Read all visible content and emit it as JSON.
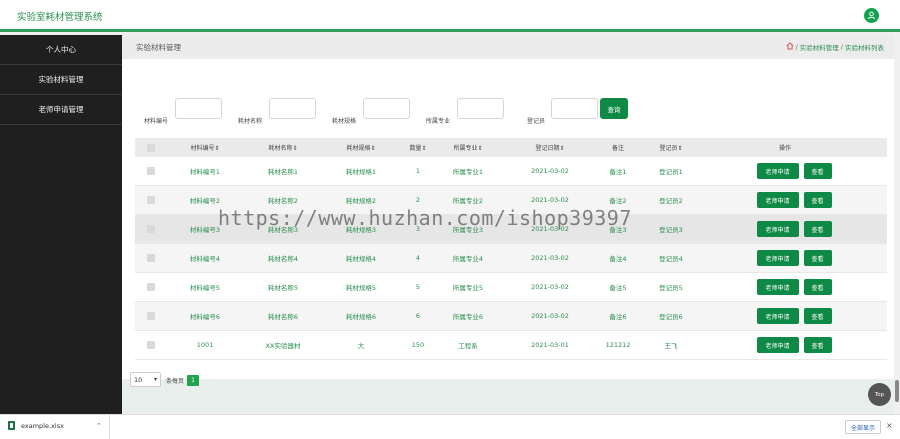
{
  "header": {
    "app_title": "实验室耗材管理系统",
    "user_icon": "user-icon"
  },
  "sidebar": {
    "items": [
      {
        "label": "个人中心"
      },
      {
        "label": "实验材料管理"
      },
      {
        "label": "老师申请管理"
      }
    ]
  },
  "breadcrumb": {
    "page_title": "实验材料管理",
    "sep": "/",
    "level1": "实验材料管理",
    "level2": "实验材料列表"
  },
  "filters": [
    {
      "label": "材料编号"
    },
    {
      "label": "耗材名称"
    },
    {
      "label": "耗材规格"
    },
    {
      "label": "所属专业"
    },
    {
      "label": "登记员"
    }
  ],
  "query_button": "查询",
  "table": {
    "headers": [
      "材料编号⇕",
      "耗材名称⇕",
      "耗材规格⇕",
      "数量⇕",
      "所属专业⇕",
      "登记日期⇕",
      "备注",
      "登记员⇕",
      "操作"
    ],
    "rows": [
      {
        "code": "材料编号1",
        "name": "耗材名称1",
        "spec": "耗材规格1",
        "qty": "1",
        "major": "所属专业1",
        "date": "2021-03-02",
        "note": "备注1",
        "registrar": "登记员1"
      },
      {
        "code": "材料编号2",
        "name": "耗材名称2",
        "spec": "耗材规格2",
        "qty": "2",
        "major": "所属专业2",
        "date": "2021-03-02",
        "note": "备注2",
        "registrar": "登记员2"
      },
      {
        "code": "材料编号3",
        "name": "耗材名称3",
        "spec": "耗材规格3",
        "qty": "3",
        "major": "所属专业3",
        "date": "2021-03-02",
        "note": "备注3",
        "registrar": "登记员3"
      },
      {
        "code": "材料编号4",
        "name": "耗材名称4",
        "spec": "耗材规格4",
        "qty": "4",
        "major": "所属专业4",
        "date": "2021-03-02",
        "note": "备注4",
        "registrar": "登记员4"
      },
      {
        "code": "材料编号5",
        "name": "耗材名称5",
        "spec": "耗材规格5",
        "qty": "5",
        "major": "所属专业5",
        "date": "2021-03-02",
        "note": "备注5",
        "registrar": "登记员5"
      },
      {
        "code": "材料编号6",
        "name": "耗材名称6",
        "spec": "耗材规格6",
        "qty": "6",
        "major": "所属专业6",
        "date": "2021-03-02",
        "note": "备注6",
        "registrar": "登记员6"
      },
      {
        "code": "1001",
        "name": "XX实验器材",
        "spec": "大",
        "qty": "150",
        "major": "工程系",
        "date": "2021-03-01",
        "note": "121212",
        "registrar": "王飞"
      }
    ],
    "action_teacher": "老师申请",
    "action_view": "查看"
  },
  "pager": {
    "page_size": "10",
    "per_page_label": "条每页",
    "current_page": "1"
  },
  "top_button": "Top",
  "watermark": "https://www.huzhan.com/ishop39397",
  "download_bar": {
    "file_name": "example.xlsx",
    "show_all": "全部显示",
    "close": "×"
  },
  "colors": {
    "accent": "#0f8a46",
    "link_text": "#2a8f4f",
    "sidebar_bg": "#1f1f1f"
  }
}
